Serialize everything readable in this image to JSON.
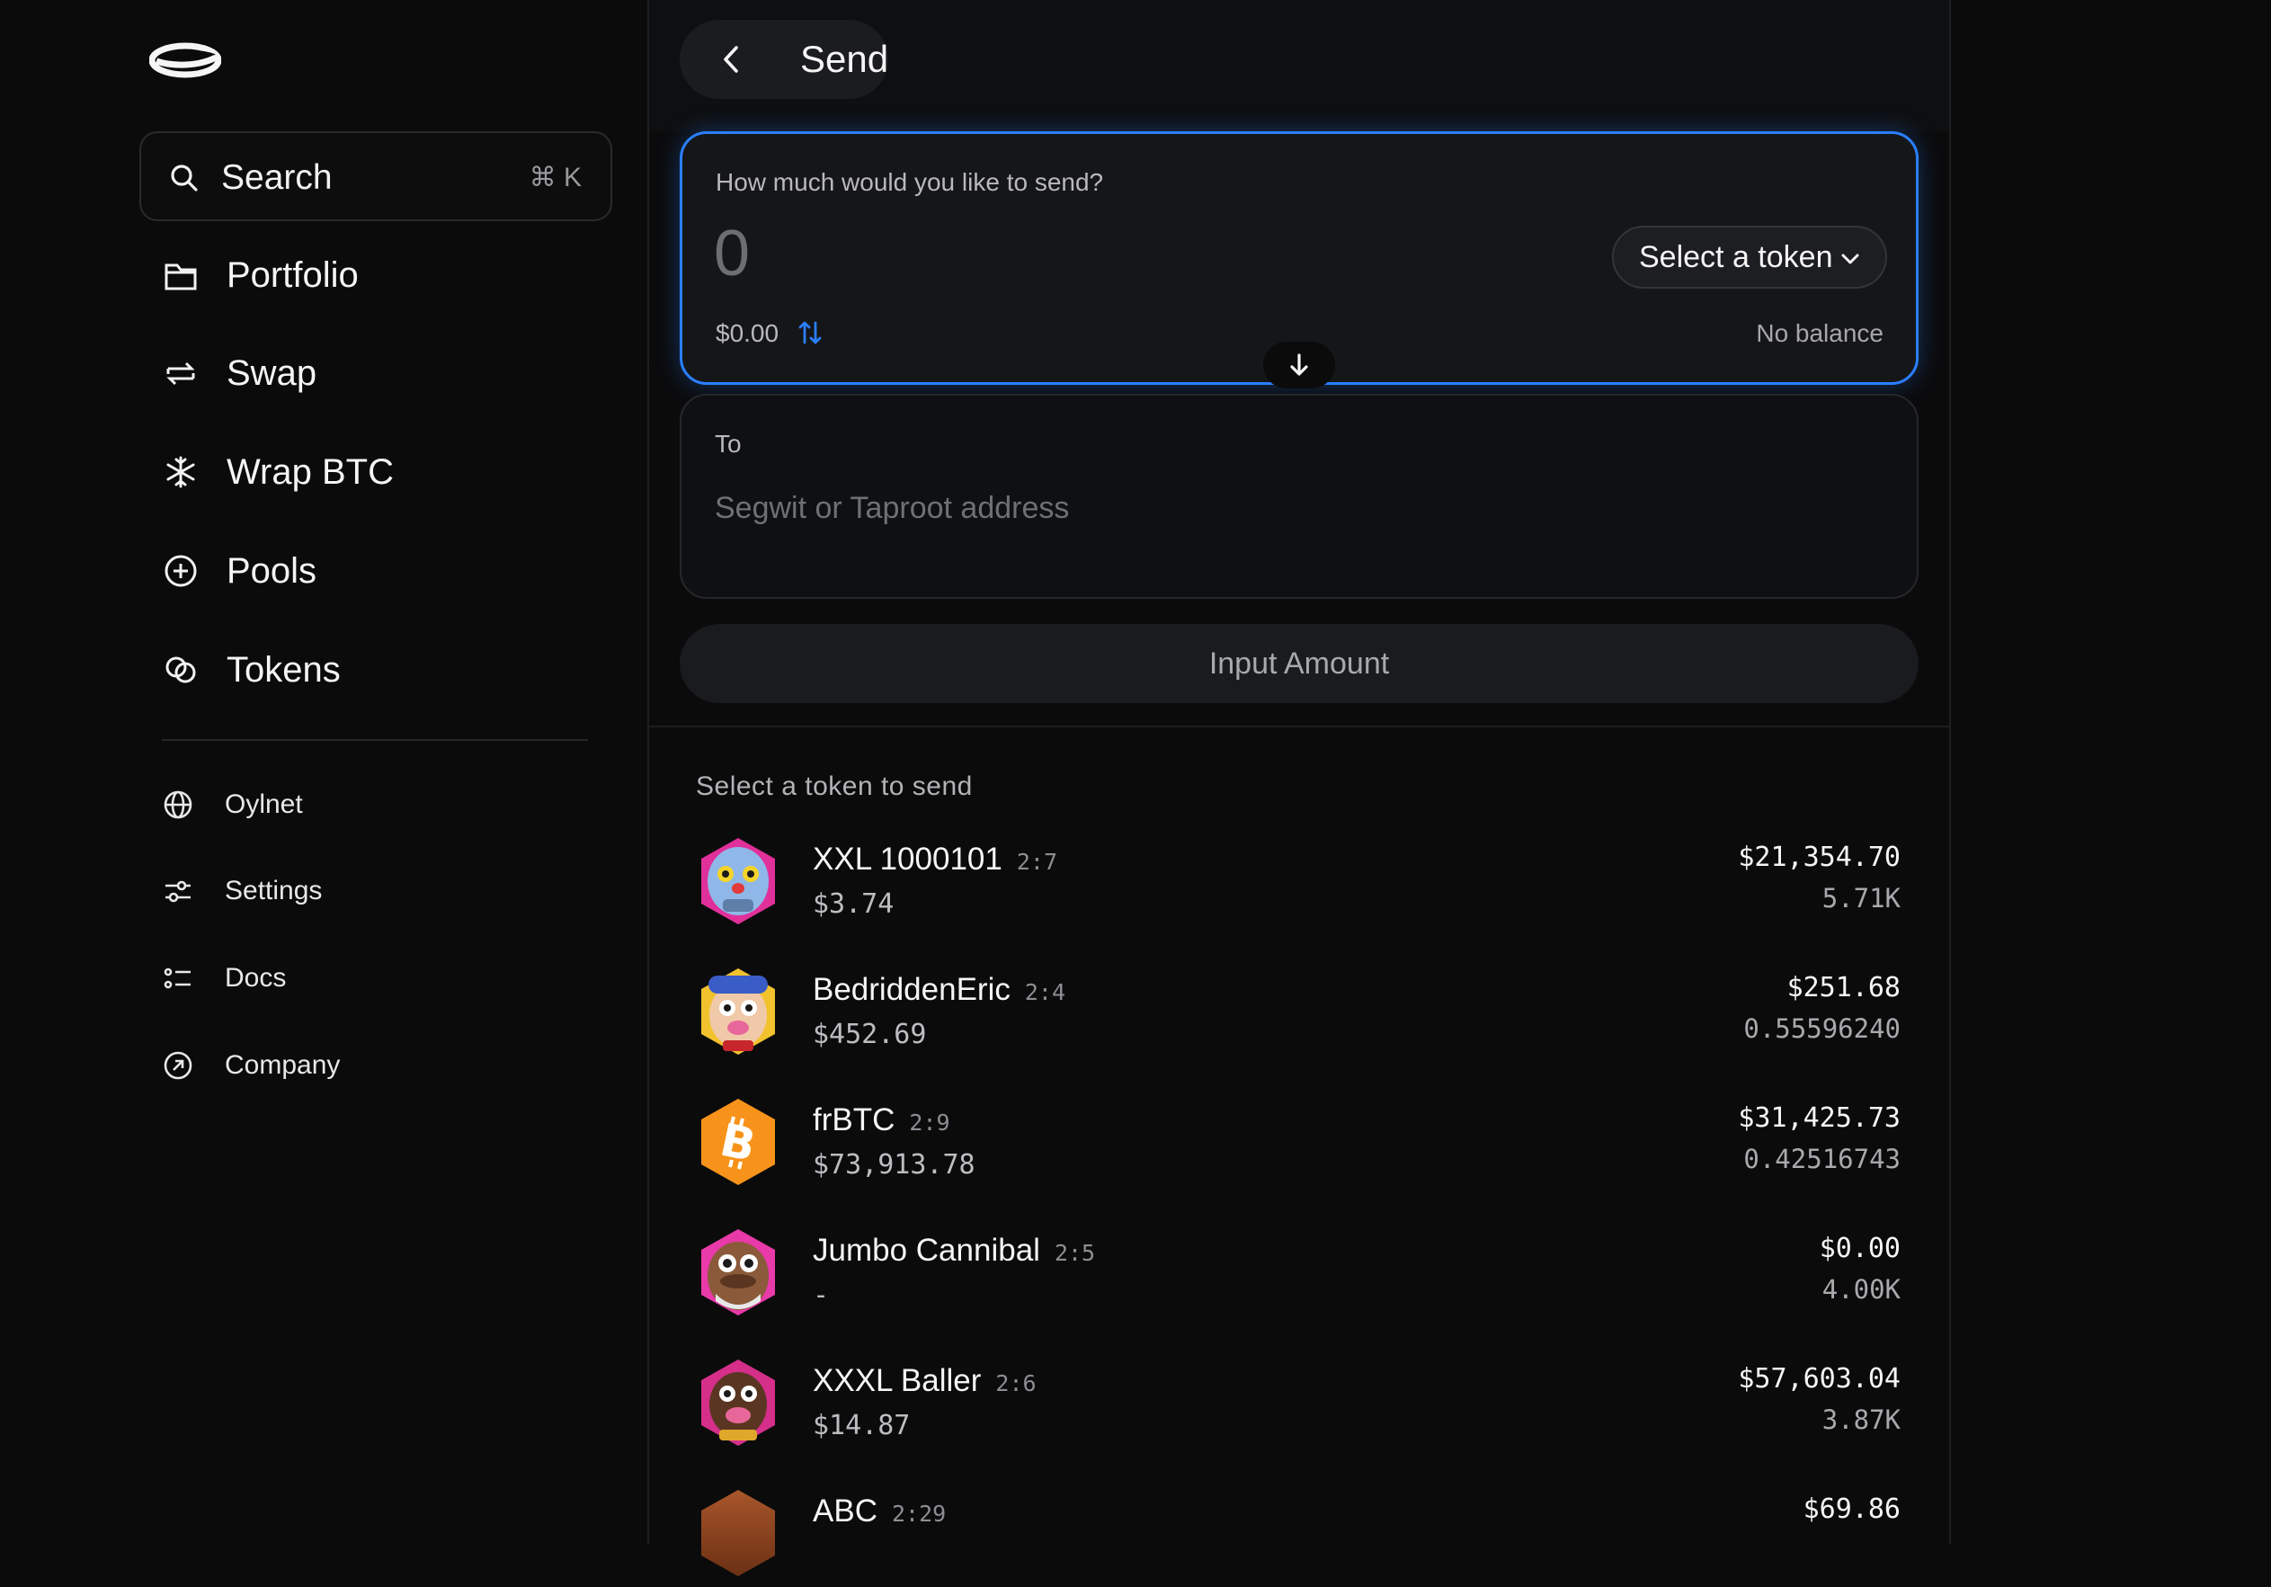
{
  "sidebar": {
    "search": {
      "label": "Search",
      "shortcut": "⌘ K"
    },
    "nav": [
      {
        "label": "Portfolio",
        "icon": "portfolio-icon"
      },
      {
        "label": "Swap",
        "icon": "swap-icon"
      },
      {
        "label": "Wrap BTC",
        "icon": "snowflake-icon"
      },
      {
        "label": "Pools",
        "icon": "plus-circle-icon"
      },
      {
        "label": "Tokens",
        "icon": "tokens-icon"
      }
    ],
    "secondary": [
      {
        "label": "Oylnet",
        "icon": "globe-icon"
      },
      {
        "label": "Settings",
        "icon": "sliders-icon"
      },
      {
        "label": "Docs",
        "icon": "list-icon"
      },
      {
        "label": "Company",
        "icon": "arrow-circle-icon"
      }
    ]
  },
  "header": {
    "back_label": "Send"
  },
  "send": {
    "question": "How much would you like to send?",
    "amount": "0",
    "usd": "$0.00",
    "token_select": "Select a token",
    "balance": "No balance",
    "to_label": "To",
    "to_placeholder": "Segwit or Taproot address",
    "submit": "Input Amount"
  },
  "token_list": {
    "title": "Select a token to send",
    "tokens": [
      {
        "name": "XXL 1000101",
        "id": "2:7",
        "price": "$3.74",
        "value": "$21,354.70",
        "qty": "5.71K",
        "avatar": "character-avatar"
      },
      {
        "name": "BedriddenEric",
        "id": "2:4",
        "price": "$452.69",
        "value": "$251.68",
        "qty": "0.55596240",
        "avatar": "character-avatar"
      },
      {
        "name": "frBTC",
        "id": "2:9",
        "price": "$73,913.78",
        "value": "$31,425.73",
        "qty": "0.42516743",
        "avatar": "bitcoin-icon"
      },
      {
        "name": "Jumbo Cannibal",
        "id": "2:5",
        "price": "-",
        "value": "$0.00",
        "qty": "4.00K",
        "avatar": "character-avatar"
      },
      {
        "name": "XXXL Baller",
        "id": "2:6",
        "price": "$14.87",
        "value": "$57,603.04",
        "qty": "3.87K",
        "avatar": "character-avatar"
      },
      {
        "name": "ABC",
        "id": "2:29",
        "price": "",
        "value": "$69.86",
        "qty": "",
        "avatar": "token-avatar"
      }
    ]
  },
  "colors": {
    "accent": "#2a7fff",
    "bitcoin": "#f7931a",
    "background": "#0b0b0c"
  }
}
